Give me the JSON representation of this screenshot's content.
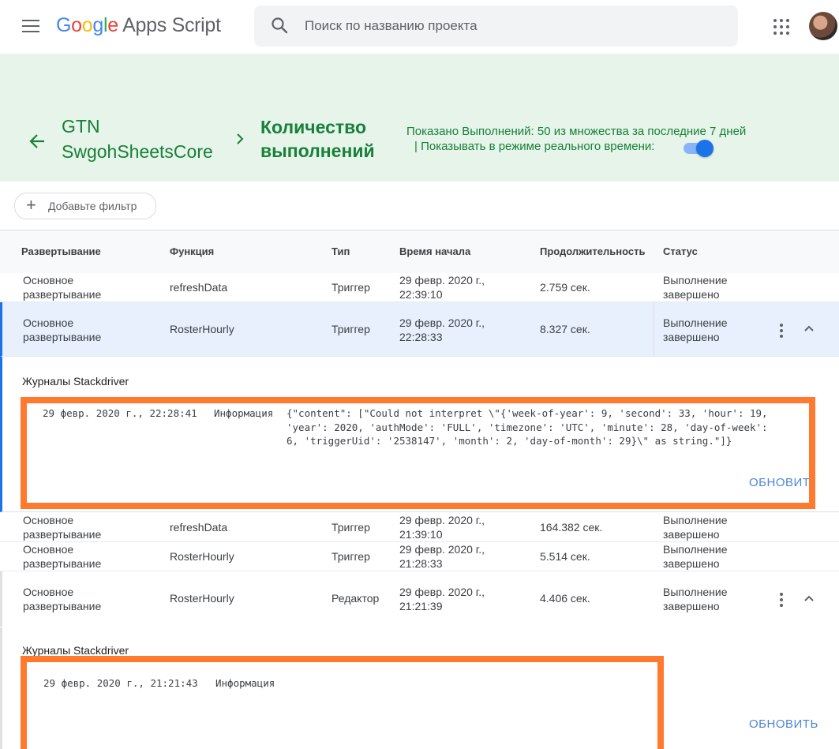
{
  "header": {
    "logo_google": [
      "G",
      "o",
      "o",
      "g",
      "l",
      "e"
    ],
    "logo_product": "Apps Script",
    "search_placeholder": "Поиск по названию проекта"
  },
  "project": {
    "name_line1": "GTN",
    "name_line2": "SwgohSheetsCore",
    "page_title_line1": "Количество",
    "page_title_line2": "выполнений",
    "shown_text": "Показано Выполнений: 50 из множества за последние 7 дней",
    "realtime_text": "|  Показывать в режиме реального времени:",
    "realtime_on": true
  },
  "filter": {
    "label": "Добавьте фильтр"
  },
  "table": {
    "columns": [
      "Развертывание",
      "Функция",
      "Тип",
      "Время начала",
      "Продолжительность",
      "Статус"
    ],
    "rows": [
      {
        "deploy1": "Основное",
        "deploy2": "развертывание",
        "func": "refreshData",
        "type": "Триггер",
        "time1": "29 февр. 2020 г.,",
        "time2": "22:39:10",
        "dur": "2.759 сек.",
        "status1": "Выполнение",
        "status2": "завершено"
      },
      {
        "deploy1": "Основное",
        "deploy2": "развертывание",
        "func": "RosterHourly",
        "type": "Триггер",
        "time1": "29 февр. 2020 г.,",
        "time2": "22:28:33",
        "dur": "8.327 сек.",
        "status1": "Выполнение",
        "status2": "завершено"
      },
      {
        "deploy1": "Основное",
        "deploy2": "развертывание",
        "func": "refreshData",
        "type": "Триггер",
        "time1": "29 февр. 2020 г.,",
        "time2": "21:39:10",
        "dur": "164.382 сек.",
        "status1": "Выполнение",
        "status2": "завершено"
      },
      {
        "deploy1": "Основное",
        "deploy2": "развертывание",
        "func": "RosterHourly",
        "type": "Триггер",
        "time1": "29 февр. 2020 г.,",
        "time2": "21:28:33",
        "dur": "5.514 сек.",
        "status1": "Выполнение",
        "status2": "завершено"
      },
      {
        "deploy1": "Основное",
        "deploy2": "развертывание",
        "func": "RosterHourly",
        "type": "Редактор",
        "time1": "29 февр. 2020 г.,",
        "time2": "21:21:39",
        "dur": "4.406 сек.",
        "status1": "Выполнение",
        "status2": "завершено"
      }
    ]
  },
  "logs": [
    {
      "heading": "Журналы Stackdriver",
      "timestamp": "29 февр. 2020 г., 22:28:41",
      "level": "Информация",
      "message_lines": [
        "{\"content\": [\"Could not interpret \\\"{'week-of-year': 9, 'second': 33, 'hour': 19,",
        "'year': 2020, 'authMode': 'FULL', 'timezone': 'UTC', 'minute': 28, 'day-of-week':",
        "6, 'triggerUid': '2538147', 'month': 2, 'day-of-month': 29}\\\" as string.\"]}"
      ],
      "refresh_label": "ОБНОВИТ"
    },
    {
      "heading": "Журналы Stackdriver",
      "timestamp": "29 февр. 2020 г., 21:21:43",
      "level": "Информация",
      "refresh_label": "ОБНОВИТЬ"
    }
  ],
  "colors": {
    "accent_green": "#188038",
    "band_green": "#e6f4ea",
    "highlight_orange": "#ff7a2f",
    "link_blue": "#4a86d6"
  }
}
